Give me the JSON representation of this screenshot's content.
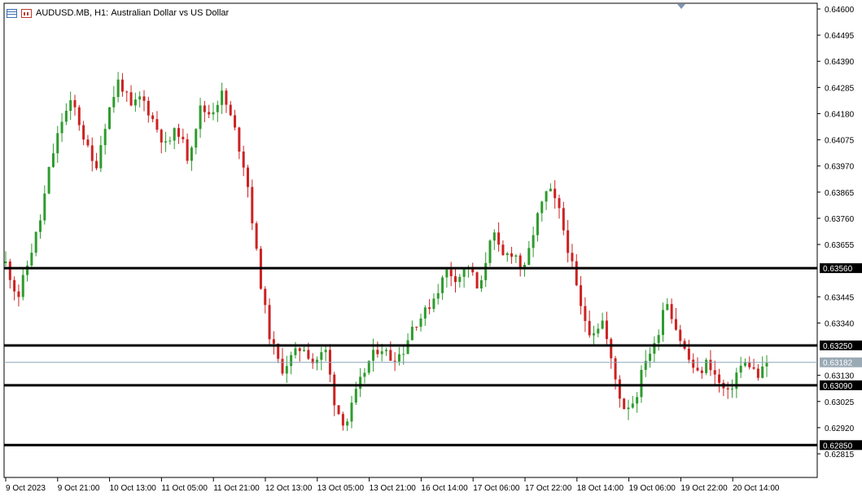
{
  "header": {
    "symbol": "AUDUSD.MB, H1:",
    "description": "Australian Dollar vs US Dollar"
  },
  "colors": {
    "bull": "#2e9b2e",
    "bear": "#cc2222",
    "line": "#000000",
    "bid": "#8aa6b8",
    "tag_bg": "#000000",
    "bid_tag_bg": "#9aaab4"
  },
  "icons": [
    "list-icon",
    "chart-icon",
    "scroll-marker-icon"
  ],
  "chart_data": {
    "type": "candlestick",
    "ylim": [
      0.62815,
      0.646
    ],
    "y_ticks": [
      "0.64600",
      "0.64495",
      "0.64390",
      "0.64285",
      "0.64180",
      "0.64075",
      "0.63970",
      "0.63865",
      "0.63760",
      "0.63655",
      "0.63445",
      "0.63340",
      "0.63130",
      "0.63025",
      "0.62920",
      "0.62815"
    ],
    "x_ticks": [
      "9 Oct 2023",
      "9 Oct 21:00",
      "10 Oct 13:00",
      "11 Oct 05:00",
      "11 Oct 21:00",
      "12 Oct 13:00",
      "13 Oct 05:00",
      "13 Oct 21:00",
      "16 Oct 14:00",
      "17 Oct 06:00",
      "17 Oct 22:00",
      "18 Oct 14:00",
      "19 Oct 06:00",
      "19 Oct 22:00",
      "20 Oct 14:00"
    ],
    "horizontal_lines": [
      {
        "label": "0.63560",
        "value": 0.6356
      },
      {
        "label": "0.63250",
        "value": 0.6325
      },
      {
        "label": "0.63090",
        "value": 0.6309
      },
      {
        "label": "0.62850",
        "value": 0.6285
      }
    ],
    "bid": {
      "label": "0.63182",
      "value": 0.63182
    },
    "path": [
      [
        0,
        0.6358
      ],
      [
        6,
        0.6344
      ],
      [
        12,
        0.6361
      ],
      [
        17,
        0.6375
      ],
      [
        22,
        0.6398
      ],
      [
        28,
        0.6416
      ],
      [
        33,
        0.6423
      ],
      [
        38,
        0.641
      ],
      [
        44,
        0.6395
      ],
      [
        50,
        0.6417
      ],
      [
        56,
        0.6432
      ],
      [
        62,
        0.642
      ],
      [
        67,
        0.6425
      ],
      [
        73,
        0.6415
      ],
      [
        79,
        0.6405
      ],
      [
        85,
        0.6412
      ],
      [
        90,
        0.64
      ],
      [
        96,
        0.642
      ],
      [
        101,
        0.6418
      ],
      [
        107,
        0.6426
      ],
      [
        113,
        0.6412
      ],
      [
        119,
        0.6393
      ],
      [
        125,
        0.6355
      ],
      [
        130,
        0.633
      ],
      [
        136,
        0.6315
      ],
      [
        141,
        0.632
      ],
      [
        147,
        0.6325
      ],
      [
        152,
        0.6318
      ],
      [
        158,
        0.6323
      ],
      [
        163,
        0.63
      ],
      [
        168,
        0.6293
      ],
      [
        174,
        0.6308
      ],
      [
        179,
        0.6318
      ],
      [
        185,
        0.6325
      ],
      [
        190,
        0.632
      ],
      [
        196,
        0.6322
      ],
      [
        201,
        0.6333
      ],
      [
        207,
        0.6338
      ],
      [
        212,
        0.6345
      ],
      [
        218,
        0.6355
      ],
      [
        223,
        0.6352
      ],
      [
        229,
        0.6357
      ],
      [
        234,
        0.6345
      ],
      [
        240,
        0.6372
      ],
      [
        245,
        0.636
      ],
      [
        251,
        0.6363
      ],
      [
        256,
        0.6354
      ],
      [
        262,
        0.6375
      ],
      [
        268,
        0.6388
      ],
      [
        273,
        0.638
      ],
      [
        279,
        0.636
      ],
      [
        284,
        0.634
      ],
      [
        289,
        0.633
      ],
      [
        295,
        0.6335
      ],
      [
        300,
        0.6315
      ],
      [
        305,
        0.63
      ],
      [
        311,
        0.6303
      ],
      [
        316,
        0.632
      ],
      [
        321,
        0.6325
      ],
      [
        326,
        0.6345
      ],
      [
        332,
        0.633
      ],
      [
        337,
        0.632
      ],
      [
        342,
        0.6313
      ],
      [
        347,
        0.6319
      ],
      [
        352,
        0.631
      ],
      [
        357,
        0.6305
      ],
      [
        362,
        0.6316
      ],
      [
        367,
        0.6318
      ],
      [
        372,
        0.6312
      ],
      [
        376,
        0.6318
      ]
    ],
    "candle_count": 177
  }
}
